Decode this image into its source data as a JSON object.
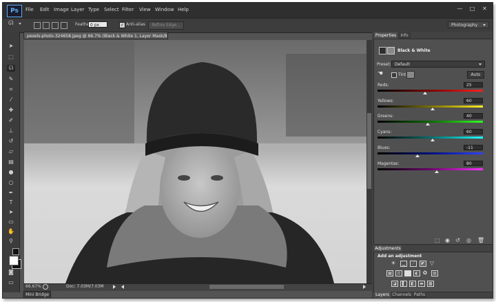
{
  "app": {
    "logo": "Ps"
  },
  "menu": [
    "File",
    "Edit",
    "Image",
    "Layer",
    "Type",
    "Select",
    "Filter",
    "View",
    "Window",
    "Help"
  ],
  "window_controls": [
    "—",
    "□",
    "✕"
  ],
  "options": {
    "feather_label": "Feather:",
    "feather_value": "0 px",
    "antialias_label": "Anti-alias",
    "refine_label": "Refine Edge...",
    "workspace": "Photography"
  },
  "document": {
    "tab": "pexels-photo-324658.jpeg @ 66.7% (Black & White 1, Layer Mask/8) *",
    "zoom": "66.67%",
    "info": "Doc: 7.03M/7.03M"
  },
  "panel_tabs": {
    "properties": "Properties",
    "info": "Info"
  },
  "properties": {
    "title": "Black & White",
    "preset_label": "Preset:",
    "preset_value": "Default",
    "tint_label": "Tint",
    "auto_label": "Auto",
    "sliders": [
      {
        "label": "Reds:",
        "value": "25"
      },
      {
        "label": "Yellows:",
        "value": "60"
      },
      {
        "label": "Greens:",
        "value": "40"
      },
      {
        "label": "Cyans:",
        "value": "60"
      },
      {
        "label": "Blues:",
        "value": "-11"
      },
      {
        "label": "Magentas:",
        "value": "80"
      }
    ]
  },
  "adjustments": {
    "tab": "Adjustments",
    "heading": "Add an adjustment"
  },
  "bottom_tabs": {
    "layers": "Layers",
    "channels": "Channels",
    "paths": "Paths"
  },
  "mini_bridge": "Mini Bridge",
  "colors": {
    "accent": "#5ab4ff",
    "chrome": "#535353",
    "panel": "#505050"
  }
}
